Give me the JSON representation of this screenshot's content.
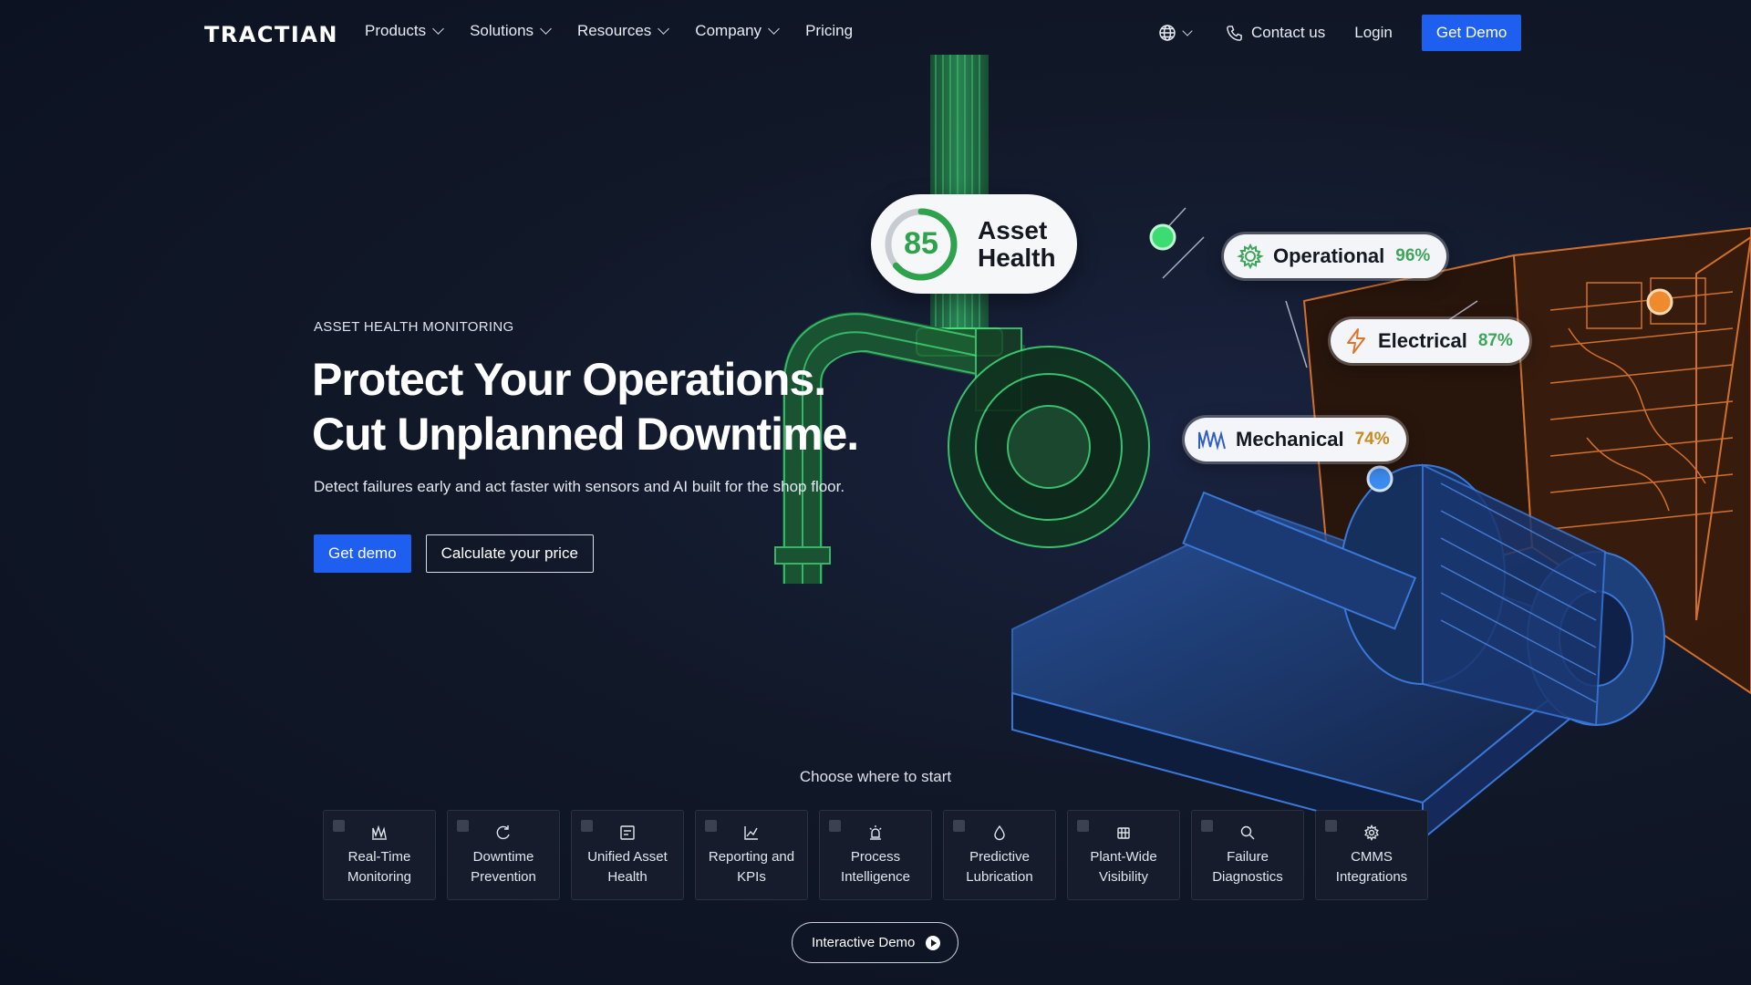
{
  "nav": {
    "logo": "TRACTIAN",
    "items": [
      {
        "label": "Products",
        "dropdown": true
      },
      {
        "label": "Solutions",
        "dropdown": true
      },
      {
        "label": "Resources",
        "dropdown": true
      },
      {
        "label": "Company",
        "dropdown": true
      },
      {
        "label": "Pricing",
        "dropdown": false
      }
    ],
    "contact_label": "Contact us",
    "login_label": "Login",
    "cta_label": "Get Demo",
    "language_icon": "globe-icon"
  },
  "hero": {
    "eyebrow": "ASSET HEALTH MONITORING",
    "headline_line1": "Protect Your Operations.",
    "headline_line2": "Cut Unplanned Downtime.",
    "subtext": "Detect failures early and act faster with sensors and AI built for the shop floor.",
    "primary_cta": "Get demo",
    "secondary_cta": "Calculate your price"
  },
  "asset_health": {
    "score": "85",
    "score_value": 85,
    "title_line1": "Asset",
    "title_line2": "Health"
  },
  "metrics": [
    {
      "label": "Operational",
      "value": "96%",
      "icon": "gear-icon",
      "color": "#3ea65a"
    },
    {
      "label": "Electrical",
      "value": "87%",
      "icon": "lightning-icon",
      "color": "#e0732c"
    },
    {
      "label": "Mechanical",
      "value": "74%",
      "icon": "waveform-icon",
      "color": "#c98a1e"
    }
  ],
  "start": {
    "title": "Choose where to start",
    "tiles": [
      {
        "line1": "Real-Time",
        "line2": "Monitoring",
        "icon": "monitoring-icon"
      },
      {
        "line1": "Downtime",
        "line2": "Prevention",
        "icon": "refresh-icon"
      },
      {
        "line1": "Unified Asset",
        "line2": "Health",
        "icon": "asset-health-icon"
      },
      {
        "line1": "Reporting and",
        "line2": "KPIs",
        "icon": "chart-icon"
      },
      {
        "line1": "Process",
        "line2": "Intelligence",
        "icon": "alarm-icon"
      },
      {
        "line1": "Predictive",
        "line2": "Lubrication",
        "icon": "drop-icon"
      },
      {
        "line1": "Plant-Wide",
        "line2": "Visibility",
        "icon": "factory-icon"
      },
      {
        "line1": "Failure",
        "line2": "Diagnostics",
        "icon": "search-icon"
      },
      {
        "line1": "CMMS",
        "line2": "Integrations",
        "icon": "settings-icon"
      }
    ],
    "interactive_label": "Interactive Demo"
  },
  "colors": {
    "accent": "#1f5ff0",
    "green": "#2fa24d",
    "orange": "#e0732c",
    "blue_line": "#3a78d8"
  }
}
